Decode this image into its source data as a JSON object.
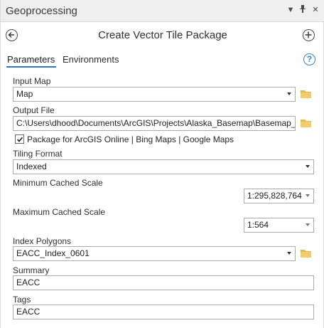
{
  "panel": {
    "title": "Geoprocessing",
    "menu_icon": "dropdown-triangle-icon",
    "pin_icon": "pin-icon",
    "close_icon": "close-icon"
  },
  "tool": {
    "title": "Create Vector Tile Package",
    "back_icon": "back-arrow-icon",
    "add_icon": "add-plus-icon"
  },
  "tabs": [
    {
      "label": "Parameters",
      "active": true
    },
    {
      "label": "Environments",
      "active": false
    }
  ],
  "help_label": "?",
  "params": {
    "input_map": {
      "label": "Input Map",
      "value": "Map"
    },
    "output_file": {
      "label": "Output File",
      "value": "C:\\Users\\dhood\\Documents\\ArcGIS\\Projects\\Alaska_Basemap\\Basemap_E"
    },
    "package_online": {
      "label": "Package for ArcGIS Online | Bing Maps | Google Maps",
      "checked": true
    },
    "tiling_format": {
      "label": "Tiling Format",
      "value": "Indexed"
    },
    "min_scale": {
      "label": "Minimum Cached Scale",
      "value": "1:295,828,764"
    },
    "max_scale": {
      "label": "Maximum Cached Scale",
      "value": "1:564"
    },
    "index_polygons": {
      "label": "Index Polygons",
      "value": "EACC_Index_0601"
    },
    "summary": {
      "label": "Summary",
      "value": "EACC"
    },
    "tags": {
      "label": "Tags",
      "value": "EACC"
    }
  },
  "colors": {
    "accent": "#2f76c3",
    "folder": "#e8b84a",
    "titlebar": "#efefef"
  }
}
